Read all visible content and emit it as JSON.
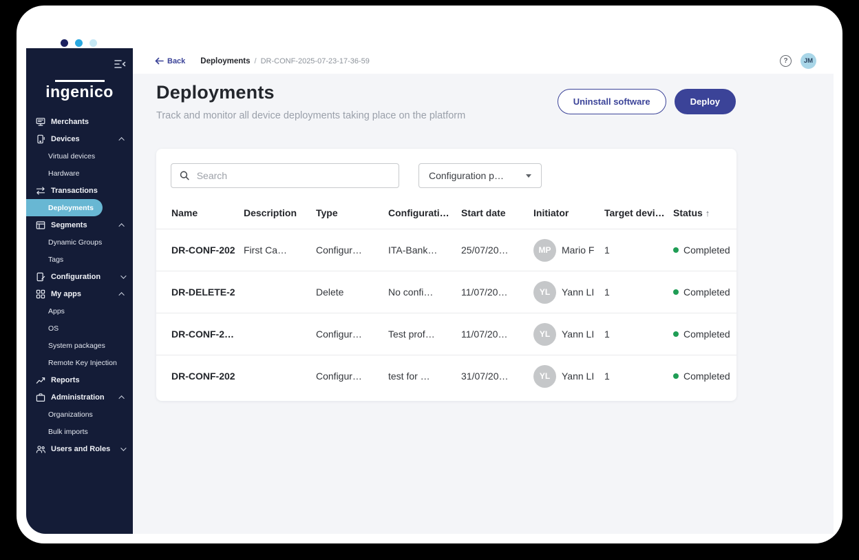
{
  "window": {
    "dots": [
      "#1b2160",
      "#29a8e0",
      "#c5e8f5"
    ]
  },
  "sidebar": {
    "logo_text": "ingenico",
    "bg_color": "#141c37",
    "active_item_color": "#68b7d3",
    "items": [
      {
        "label": "Merchants",
        "icon": "merchants-icon",
        "level": "top"
      },
      {
        "label": "Devices",
        "icon": "devices-icon",
        "level": "top",
        "chevron": "up"
      },
      {
        "label": "Virtual devices",
        "level": "sub"
      },
      {
        "label": "Hardware",
        "level": "sub"
      },
      {
        "label": "Transactions",
        "icon": "transactions-icon",
        "level": "top"
      },
      {
        "label": "Deployments",
        "level": "sub",
        "active": true
      },
      {
        "label": "Segments",
        "icon": "segments-icon",
        "level": "top",
        "chevron": "up"
      },
      {
        "label": "Dynamic Groups",
        "level": "sub"
      },
      {
        "label": "Tags",
        "level": "sub"
      },
      {
        "label": "Configuration",
        "icon": "configuration-icon",
        "level": "top",
        "chevron": "down"
      },
      {
        "label": "My apps",
        "icon": "my-apps-icon",
        "level": "top",
        "chevron": "up"
      },
      {
        "label": "Apps",
        "level": "sub"
      },
      {
        "label": "OS",
        "level": "sub"
      },
      {
        "label": "System packages",
        "level": "sub"
      },
      {
        "label": "Remote Key Injection",
        "level": "sub"
      },
      {
        "label": "Reports",
        "icon": "reports-icon",
        "level": "top"
      },
      {
        "label": "Administration",
        "icon": "administration-icon",
        "level": "top",
        "chevron": "up"
      },
      {
        "label": "Organizations",
        "level": "sub"
      },
      {
        "label": "Bulk imports",
        "level": "sub"
      },
      {
        "label": "Users and Roles",
        "icon": "users-roles-icon",
        "level": "top",
        "chevron": "down"
      }
    ]
  },
  "topbar": {
    "back_label": "Back",
    "breadcrumb_section": "Deployments",
    "breadcrumb_separator": "/",
    "breadcrumb_current": "DR-CONF-2025-07-23-17-36-59",
    "user_initials": "JM"
  },
  "page": {
    "title": "Deployments",
    "subtitle": "Track and monitor all device deployments taking place on the platform",
    "secondary_button": "Uninstall software",
    "primary_button": "Deploy"
  },
  "filters": {
    "search_placeholder": "Search",
    "configuration_filter_value": "Configuration p…",
    "sort_column": "Status",
    "sort_direction": "asc",
    "sort_arrow": "↑"
  },
  "table": {
    "columns": [
      "Name",
      "Description",
      "Type",
      "Configurati…",
      "Start date",
      "Initiator",
      "Target devi…",
      "Status"
    ],
    "rows": [
      {
        "name": "DR-CONF-202",
        "description": "First Ca…",
        "type": "Configur…",
        "configuration": "ITA-Bank…",
        "start_date": "25/07/20…",
        "initiator_initials": "MP",
        "initiator_name": "Mario F",
        "target_devices": "1",
        "status": "Completed"
      },
      {
        "name": "DR-DELETE-2",
        "description": "",
        "type": "Delete",
        "configuration": "No confi…",
        "start_date": "11/07/20…",
        "initiator_initials": "YL",
        "initiator_name": "Yann LI",
        "target_devices": "1",
        "status": "Completed"
      },
      {
        "name": "DR-CONF-2…",
        "description": "",
        "type": "Configur…",
        "configuration": "Test prof…",
        "start_date": "11/07/20…",
        "initiator_initials": "YL",
        "initiator_name": "Yann LI",
        "target_devices": "1",
        "status": "Completed"
      },
      {
        "name": "DR-CONF-202",
        "description": "",
        "type": "Configur…",
        "configuration": "test for …",
        "start_date": "31/07/20…",
        "initiator_initials": "YL",
        "initiator_name": "Yann LI",
        "target_devices": "1",
        "status": "Completed"
      }
    ]
  },
  "colors": {
    "primary": "#3b4398",
    "sidebar_bg": "#141c37",
    "active_item": "#68b7d3",
    "main_bg": "#f4f5f8",
    "status_green": "#1f9d55"
  }
}
